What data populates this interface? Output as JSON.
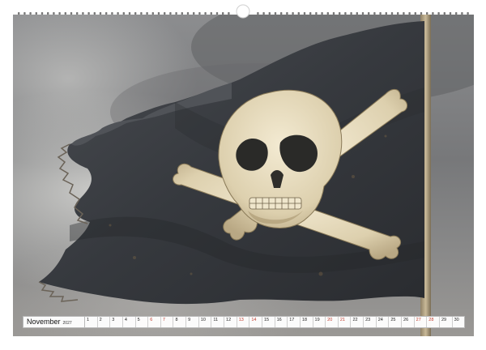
{
  "calendar": {
    "month": "November",
    "year": "2027",
    "days": [
      {
        "n": "1",
        "w": false
      },
      {
        "n": "2",
        "w": false
      },
      {
        "n": "3",
        "w": false
      },
      {
        "n": "4",
        "w": false
      },
      {
        "n": "5",
        "w": false
      },
      {
        "n": "6",
        "w": true
      },
      {
        "n": "7",
        "w": true
      },
      {
        "n": "8",
        "w": false
      },
      {
        "n": "9",
        "w": false
      },
      {
        "n": "10",
        "w": false
      },
      {
        "n": "11",
        "w": false
      },
      {
        "n": "12",
        "w": false
      },
      {
        "n": "13",
        "w": true
      },
      {
        "n": "14",
        "w": true
      },
      {
        "n": "15",
        "w": false
      },
      {
        "n": "16",
        "w": false
      },
      {
        "n": "17",
        "w": false
      },
      {
        "n": "18",
        "w": false
      },
      {
        "n": "19",
        "w": false
      },
      {
        "n": "20",
        "w": true
      },
      {
        "n": "21",
        "w": true
      },
      {
        "n": "22",
        "w": false
      },
      {
        "n": "23",
        "w": false
      },
      {
        "n": "24",
        "w": false
      },
      {
        "n": "25",
        "w": false
      },
      {
        "n": "26",
        "w": false
      },
      {
        "n": "27",
        "w": true
      },
      {
        "n": "28",
        "w": true
      },
      {
        "n": "29",
        "w": false
      },
      {
        "n": "30",
        "w": false
      }
    ]
  },
  "colors": {
    "weekend": "#c0392b",
    "flag": "#3a3d42",
    "skull": "#e8dcc0"
  },
  "icons": {
    "binding": "ring-binding-icon",
    "flag": "jolly-roger-flag-icon"
  }
}
